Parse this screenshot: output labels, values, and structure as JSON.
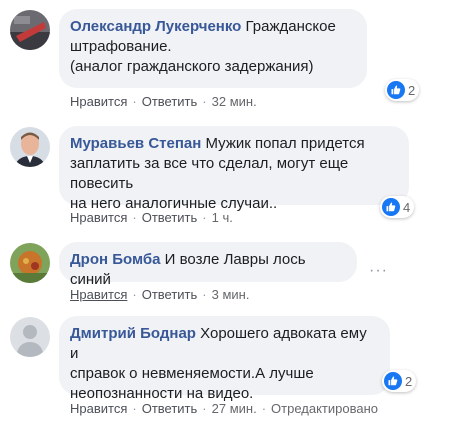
{
  "colors": {
    "accent": "#1877f2",
    "name": "#385898",
    "bubble": "#f0f2f5",
    "meta": "#65676b"
  },
  "comments": [
    {
      "author": "Олександр Лукерченко",
      "text": "Гражданское\nштрафование.\n(аналог гражданского задержания)",
      "like_label": "Нравится",
      "reply_label": "Ответить",
      "time": "32 мин.",
      "reactions": "2"
    },
    {
      "author": "Муравьев Степан",
      "text": "Мужик попал придется\nзаплатить за все что сделал, могут еще повесить\nна него аналогичные случаи..",
      "like_label": "Нравится",
      "reply_label": "Ответить",
      "time": "1 ч.",
      "reactions": "4"
    },
    {
      "author": "Дрон Бомба",
      "text": "И возле Лавры лось синий",
      "like_label": "Нравится",
      "reply_label": "Ответить",
      "time": "3 мин."
    },
    {
      "author": "Дмитрий Боднар",
      "text": "Хорошего адвоката ему и\nсправок о невменяемости.А лучше\nнеопознанности на видео.",
      "like_label": "Нравится",
      "reply_label": "Ответить",
      "time": "27 мин.",
      "edited": "Отредактировано",
      "reactions": "2"
    }
  ],
  "icons": {
    "like": "like-thumb-icon",
    "more": "more-options-icon"
  },
  "more_glyph": "···",
  "separator": "·"
}
